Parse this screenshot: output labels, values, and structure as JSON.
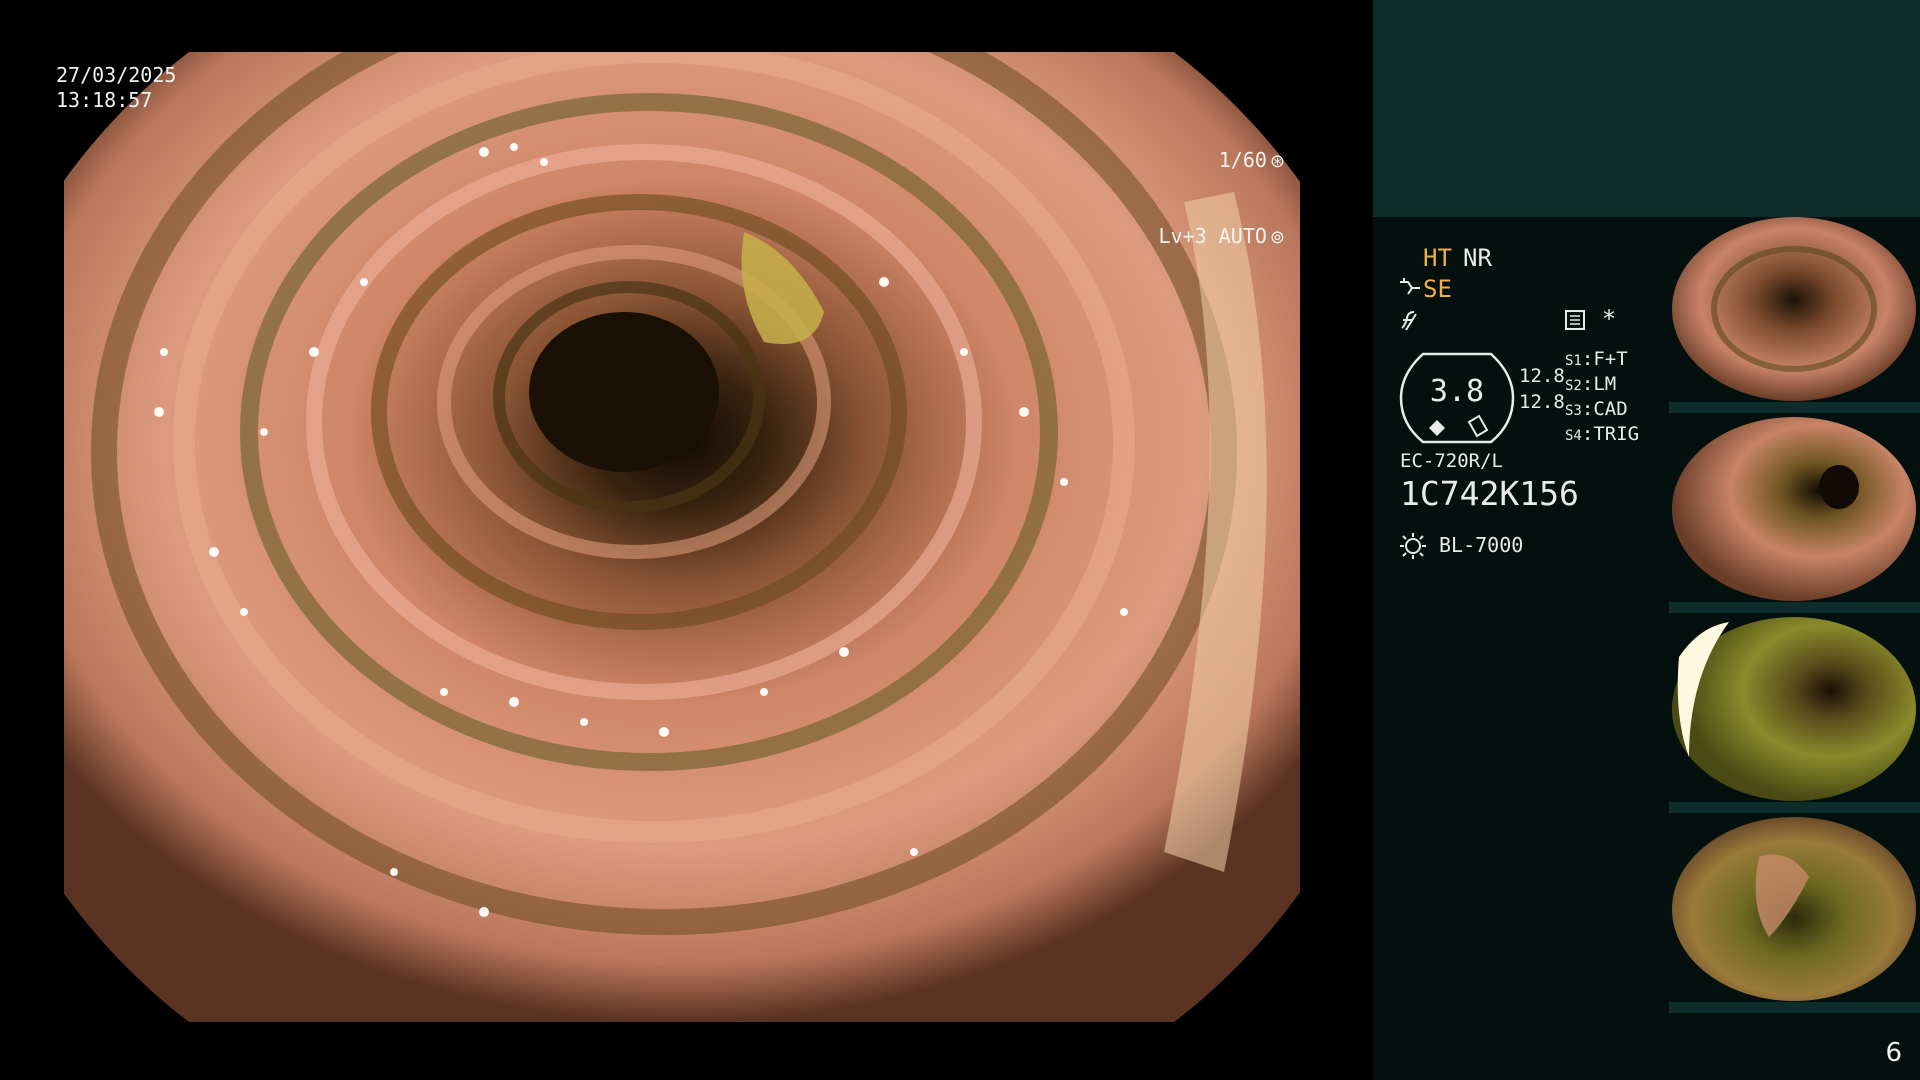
{
  "overlay": {
    "date": "27/03/2025",
    "time": "13:18:57",
    "shutter": "1/60",
    "level_mode": "Lv+3 AUTO"
  },
  "panel": {
    "ht": "HT",
    "nr": "NR",
    "se": "SE",
    "asterisk": "*",
    "gauge_value": "3.8",
    "gauge_side_1": "12.8",
    "gauge_side_2": "12.8",
    "switches": [
      {
        "key": "S1",
        "value": "F+T"
      },
      {
        "key": "S2",
        "value": "LM"
      },
      {
        "key": "S3",
        "value": "CAD"
      },
      {
        "key": "S4",
        "value": "TRIG"
      }
    ],
    "scope_model": "EC-720R/L",
    "serial": "1C742K156",
    "light_source": "BL-7000"
  },
  "page_number": "6",
  "colors": {
    "panel_top": "#0e2c2a",
    "panel_bg": "#03100e",
    "accent": "#f2b13e"
  },
  "icons": [
    "shutter-icon",
    "auto-iris-icon",
    "enhancement-icon",
    "f-symbol-icon",
    "memo-icon",
    "light-source-icon"
  ]
}
